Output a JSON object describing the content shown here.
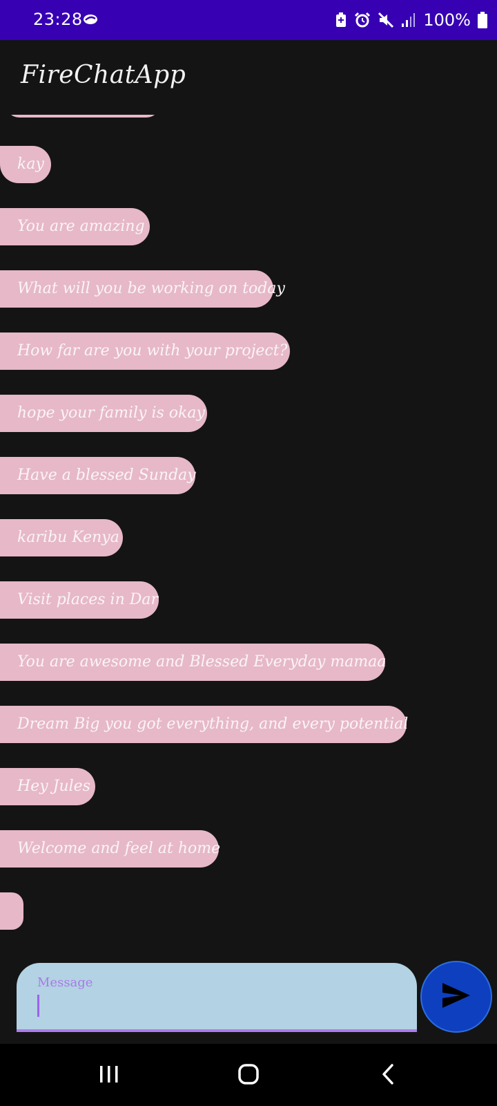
{
  "status_bar": {
    "time": "23:28",
    "battery": "100%",
    "icons": [
      "cloud-sync-icon",
      "battery-saver-icon",
      "alarm-icon",
      "mute-icon",
      "signal-icon",
      "battery-icon"
    ]
  },
  "app_bar": {
    "title": "FireChatApp"
  },
  "messages": [
    "kay",
    "You are amazing",
    "What will you be working on today",
    "How far are you with your project?",
    "hope your family is okay",
    "Have a blessed Sunday",
    "karibu Kenya",
    "Visit places in Dar",
    "You are awesome and Blessed Everyday  mamaa",
    "Dream Big you got everything, and every potential",
    "Hey Jules",
    "Welcome and feel at home",
    ""
  ],
  "composer": {
    "label": "Message",
    "value": ""
  },
  "nav_bar": {
    "icons": [
      "recents-icon",
      "home-icon",
      "back-icon"
    ]
  },
  "colors": {
    "status_bar": "#3700b3",
    "background": "#141414",
    "bubble": "#e6b8c8",
    "composer": "#b3d2e3",
    "accent": "#b07cf0",
    "send_button": "#0e3fbf"
  }
}
